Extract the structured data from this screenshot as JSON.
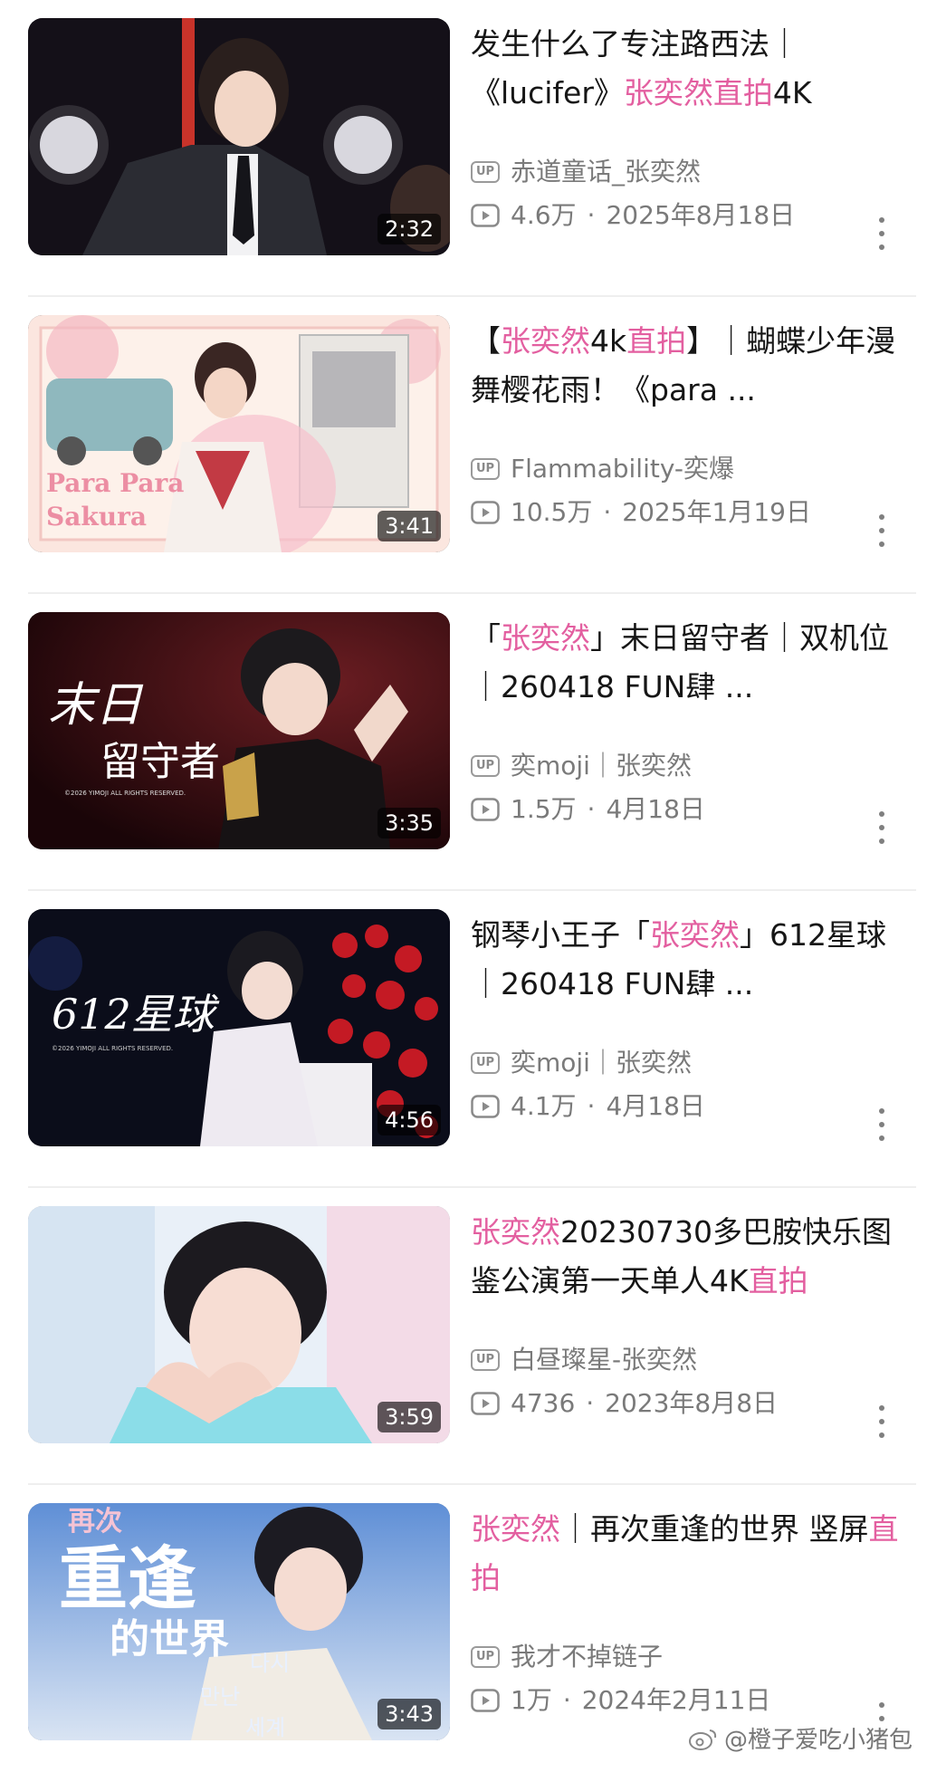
{
  "videos": [
    {
      "title_parts": [
        {
          "t": "发生什么了专注路西法｜《lucifer》",
          "hl": false
        },
        {
          "t": "张奕然",
          "hl": true
        },
        {
          "t": "直拍",
          "hl": true
        },
        {
          "t": "4K",
          "hl": false
        }
      ],
      "uploader": "赤道童话_张奕然",
      "views": "4.6万",
      "date": "2025年8月18日",
      "duration": "2:32",
      "thumb_theme": "stage-dark"
    },
    {
      "title_parts": [
        {
          "t": "【",
          "hl": false
        },
        {
          "t": "张奕然",
          "hl": true
        },
        {
          "t": "4k",
          "hl": false
        },
        {
          "t": "直拍",
          "hl": true
        },
        {
          "t": "】｜蝴蝶少年漫舞樱花雨！《para ...",
          "hl": false
        }
      ],
      "uploader": "Flammability-奕爆",
      "views": "10.5万",
      "date": "2025年1月19日",
      "duration": "3:41",
      "thumb_theme": "pink-retro",
      "thumb_text": [
        "Para Para",
        "Sakura"
      ]
    },
    {
      "title_parts": [
        {
          "t": "「",
          "hl": false
        },
        {
          "t": "张奕然",
          "hl": true
        },
        {
          "t": "」末日留守者｜双机位｜260418 FUN肆 ...",
          "hl": false
        }
      ],
      "uploader": "奕moji｜张奕然",
      "views": "1.5万",
      "date": "4月18日",
      "duration": "3:35",
      "thumb_theme": "red-stage",
      "thumb_text": [
        "末日",
        "留守者"
      ]
    },
    {
      "title_parts": [
        {
          "t": "钢琴小王子「",
          "hl": false
        },
        {
          "t": "张奕然",
          "hl": true
        },
        {
          "t": "」612星球｜260418 FUN肆 ...",
          "hl": false
        }
      ],
      "uploader": "奕moji｜张奕然",
      "views": "4.1万",
      "date": "4月18日",
      "duration": "4:56",
      "thumb_theme": "dark-roses",
      "thumb_text": [
        "612星球"
      ]
    },
    {
      "title_parts": [
        {
          "t": "张奕然",
          "hl": true
        },
        {
          "t": "20230730多巴胺快乐图鉴公演第一天单人4K",
          "hl": false
        },
        {
          "t": "直拍",
          "hl": true
        }
      ],
      "uploader": "白昼璨星-张奕然",
      "views": "4736",
      "date": "2023年8月8日",
      "duration": "3:59",
      "thumb_theme": "bright-pastel"
    },
    {
      "title_parts": [
        {
          "t": "张奕然",
          "hl": true
        },
        {
          "t": "｜再次重逢的世界 竖屏",
          "hl": false
        },
        {
          "t": "直拍",
          "hl": true
        }
      ],
      "uploader": "我才不掉链子",
      "views": "1万",
      "date": "2024年2月11日",
      "duration": "3:43",
      "thumb_theme": "blue-soft",
      "thumb_text": [
        "再次",
        "重逢",
        "的世界",
        "다시",
        "만난",
        "세계"
      ]
    }
  ],
  "badge_label": "UP",
  "separator": "·",
  "watermark": "@橙子爱吃小猪包",
  "colors": {
    "highlight": "#e35fa0",
    "meta": "#7a7a7a"
  }
}
